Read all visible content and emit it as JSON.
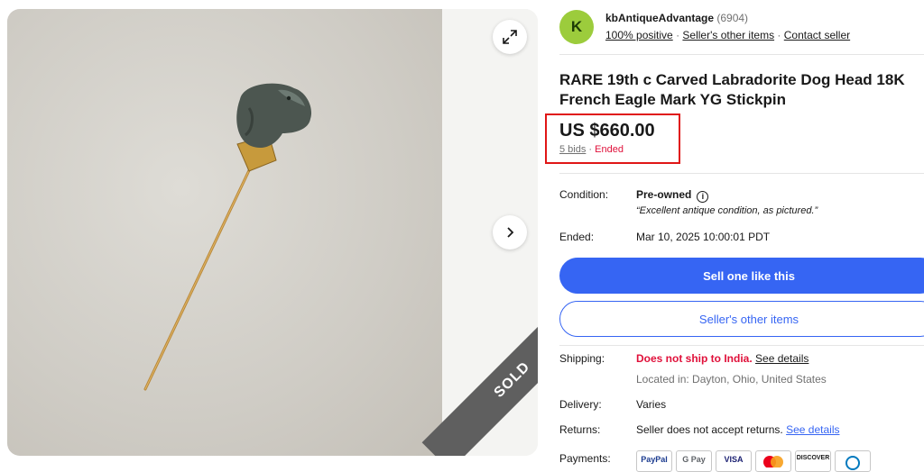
{
  "gallery": {
    "sold_label": "SOLD"
  },
  "seller": {
    "avatar_letter": "K",
    "name": "kbAntiqueAdvantage",
    "feedback_count": "(6904)",
    "positive": "100% positive",
    "other_items": "Seller's other items",
    "contact": "Contact seller"
  },
  "listing": {
    "title": "RARE 19th c Carved Labradorite Dog Head 18K French Eagle Mark YG Stickpin",
    "price": "US $660.00",
    "bids": "5 bids",
    "status": "Ended"
  },
  "details": {
    "condition_label": "Condition:",
    "condition_value": "Pre-owned",
    "condition_quote": "“Excellent antique condition, as pictured.”",
    "ended_label": "Ended:",
    "ended_value": "Mar 10, 2025 10:00:01 PDT"
  },
  "actions": {
    "sell_one": "Sell one like this",
    "seller_other_items": "Seller's other items"
  },
  "shipping": {
    "label": "Shipping:",
    "notice": "Does not ship to India.",
    "see_details": "See details",
    "location": "Located in: Dayton, Ohio, United States"
  },
  "delivery": {
    "label": "Delivery:",
    "value": "Varies"
  },
  "returns": {
    "label": "Returns:",
    "value": "Seller does not accept returns.",
    "see_details": "See details"
  },
  "payments": {
    "label": "Payments:",
    "methods": [
      "PayPal",
      "G Pay",
      "VISA",
      "",
      "DISCOVER",
      ""
    ]
  },
  "colors": {
    "accent": "#3665f3",
    "alert": "#e0103a",
    "highlight_box": "#e01616",
    "avatar": "#9ccc3c"
  }
}
